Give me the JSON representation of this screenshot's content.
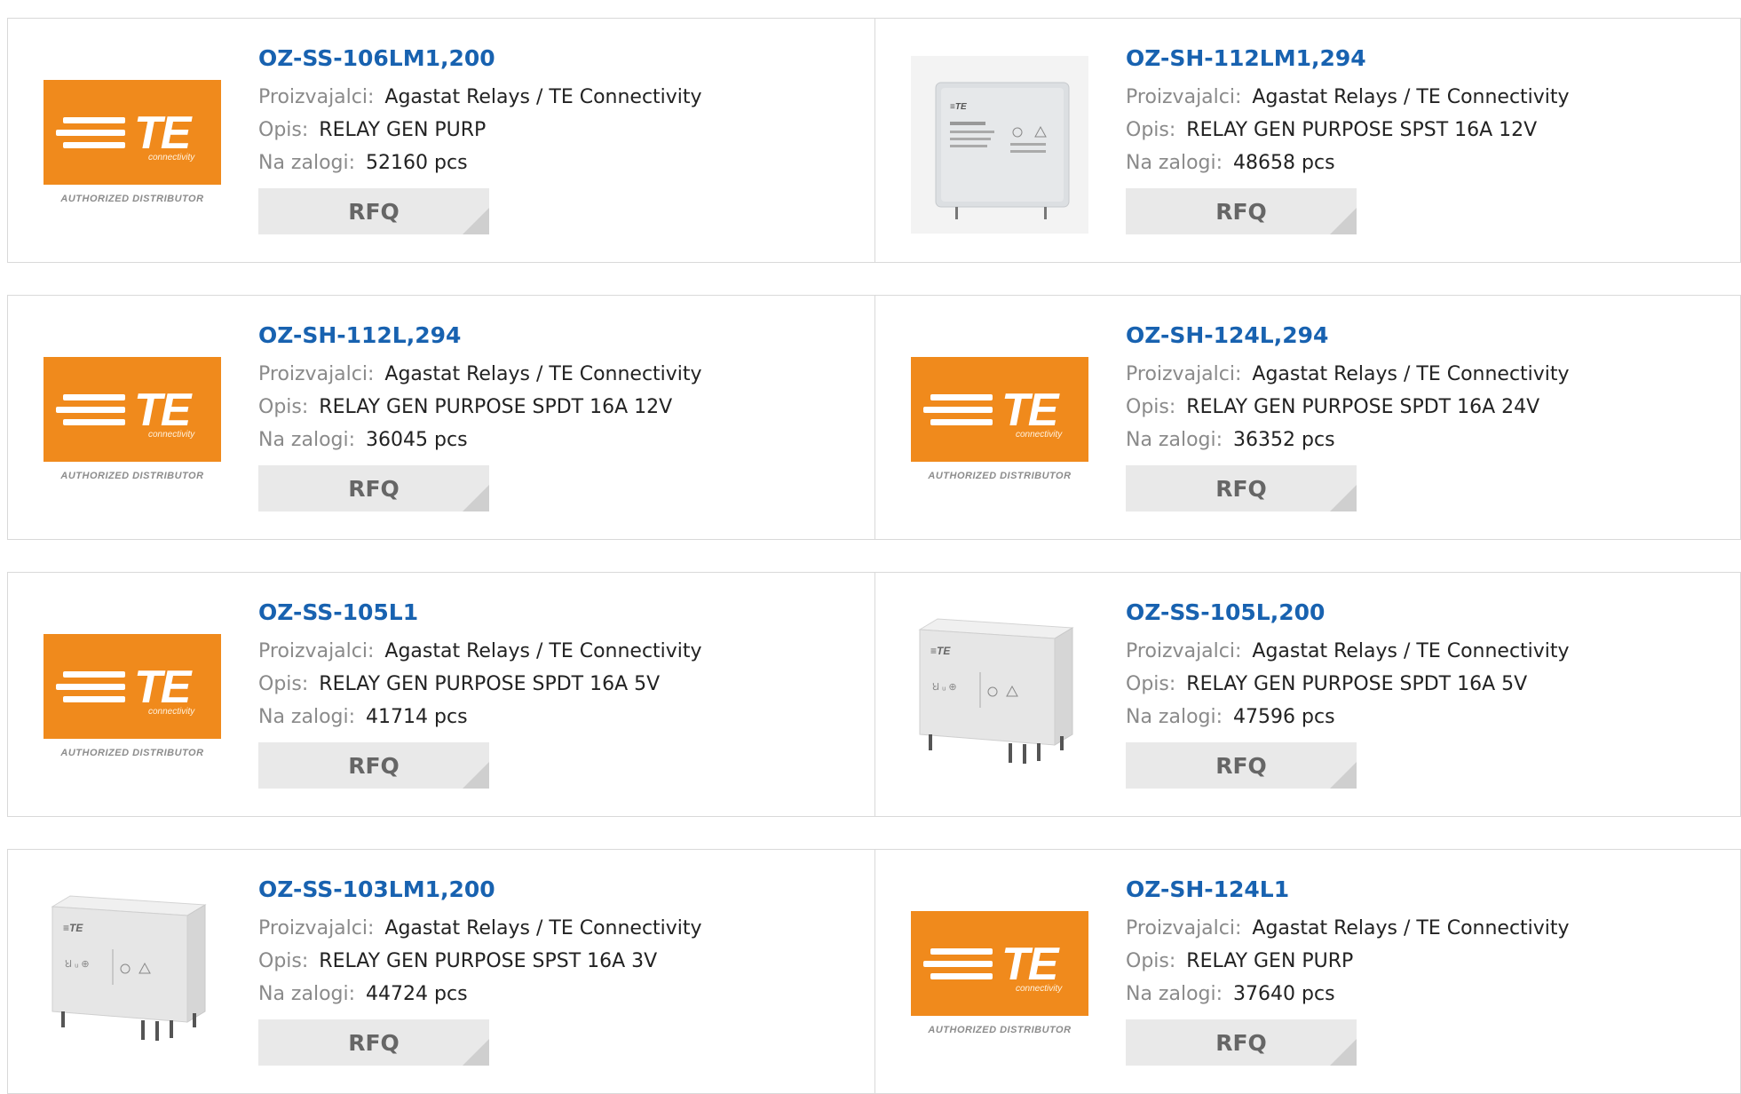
{
  "labels": {
    "manufacturer": "Proizvajalci:",
    "description": "Opis:",
    "stock": "Na zalogi:",
    "rfq": "RFQ"
  },
  "logo": {
    "brand": "TE",
    "sub": "connectivity",
    "authorized": "AUTHORIZED DISTRIBUTOR",
    "color": "#f08a1c"
  },
  "products": [
    {
      "pn": "OZ-SS-106LM1,200",
      "manufacturer": "Agastat Relays / TE Connectivity",
      "description": "RELAY GEN PURP",
      "stock": "52160 pcs",
      "image": "te-logo"
    },
    {
      "pn": "OZ-SH-112LM1,294",
      "manufacturer": "Agastat Relays / TE Connectivity",
      "description": "RELAY GEN PURPOSE SPST 16A 12V",
      "stock": "48658 pcs",
      "image": "relay-front"
    },
    {
      "pn": "OZ-SH-112L,294",
      "manufacturer": "Agastat Relays / TE Connectivity",
      "description": "RELAY GEN PURPOSE SPDT 16A 12V",
      "stock": "36045 pcs",
      "image": "te-logo"
    },
    {
      "pn": "OZ-SH-124L,294",
      "manufacturer": "Agastat Relays / TE Connectivity",
      "description": "RELAY GEN PURPOSE SPDT 16A 24V",
      "stock": "36352 pcs",
      "image": "te-logo"
    },
    {
      "pn": "OZ-SS-105L1",
      "manufacturer": "Agastat Relays / TE Connectivity",
      "description": "RELAY GEN PURPOSE SPDT 16A 5V",
      "stock": "41714 pcs",
      "image": "te-logo"
    },
    {
      "pn": "OZ-SS-105L,200",
      "manufacturer": "Agastat Relays / TE Connectivity",
      "description": "RELAY GEN PURPOSE SPDT 16A 5V",
      "stock": "47596 pcs",
      "image": "relay-angle"
    },
    {
      "pn": "OZ-SS-103LM1,200",
      "manufacturer": "Agastat Relays / TE Connectivity",
      "description": "RELAY GEN PURPOSE SPST 16A 3V",
      "stock": "44724 pcs",
      "image": "relay-angle"
    },
    {
      "pn": "OZ-SH-124L1",
      "manufacturer": "Agastat Relays / TE Connectivity",
      "description": "RELAY GEN PURP",
      "stock": "37640 pcs",
      "image": "te-logo"
    }
  ]
}
